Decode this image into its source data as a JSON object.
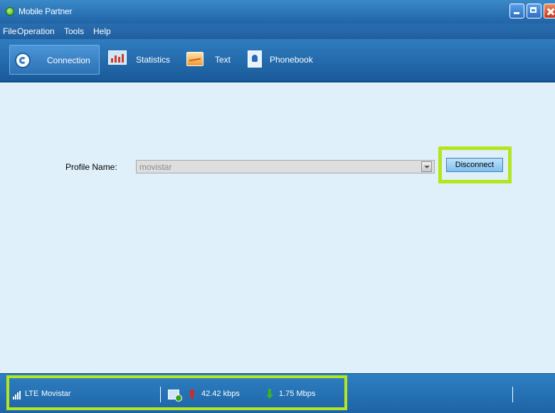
{
  "window": {
    "title": "Mobile Partner"
  },
  "menu": {
    "items": [
      "File",
      "Operation",
      "Tools",
      "Help"
    ]
  },
  "toolbar": {
    "items": [
      {
        "label": "Connection",
        "icon": "connection-icon",
        "active": true
      },
      {
        "label": "Statistics",
        "icon": "statistics-icon",
        "active": false
      },
      {
        "label": "Text",
        "icon": "text-message-icon",
        "active": false
      },
      {
        "label": "Phonebook",
        "icon": "phonebook-icon",
        "active": false
      }
    ]
  },
  "connection": {
    "profile_label": "Profile Name:",
    "profile_value": "movistar",
    "disconnect_label": "Disconnect"
  },
  "status": {
    "network_type": "LTE",
    "operator": "Movistar",
    "upload_speed": "42.42 kbps",
    "download_speed": "1.75 Mbps"
  },
  "colors": {
    "highlight": "#b5e61d",
    "chrome_blue": "#1f64a8",
    "content_bg": "#dff0fb"
  }
}
